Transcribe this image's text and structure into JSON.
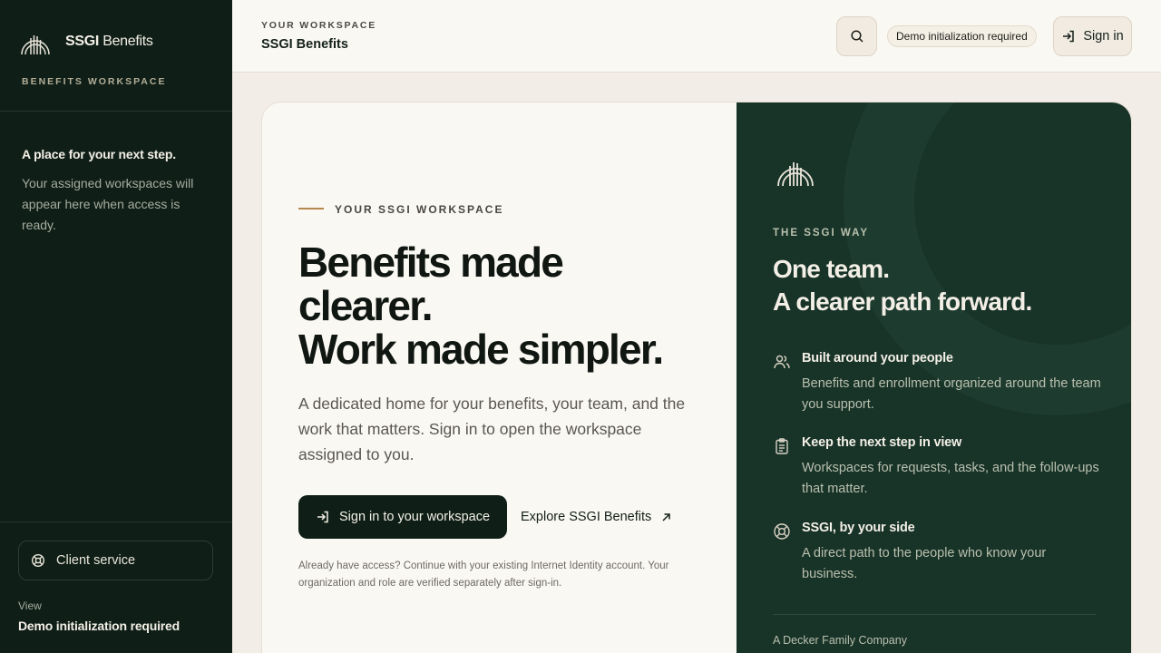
{
  "sidebar": {
    "brand_bold": "SSGI",
    "brand_rest": " Benefits",
    "subtitle": "BENEFITS WORKSPACE",
    "heading": "A place for your next step.",
    "text": "Your assigned workspaces will appear here when access is ready.",
    "client_service_label": "Client service",
    "view_label": "View",
    "view_value": "Demo initialization required"
  },
  "header": {
    "eyebrow": "YOUR WORKSPACE",
    "title": "SSGI Benefits",
    "search_icon": "search-icon",
    "badge": "Demo initialization required",
    "signin_label": "Sign in"
  },
  "main": {
    "eyebrow": "YOUR SSGI WORKSPACE",
    "headline": [
      "Benefits made",
      "clearer.",
      "Work made simpler."
    ],
    "description": "A dedicated home for your benefits, your team, and the work that matters. Sign in to open the workspace assigned to you.",
    "primary_button": "Sign in to your workspace",
    "explore_link": "Explore SSGI Benefits",
    "fine_print": "Already have access? Continue with your existing Internet Identity account. Your organization and role are verified separately after sign-in."
  },
  "panel": {
    "eyebrow": "THE SSGI WAY",
    "title": [
      "One team.",
      "A clearer path forward."
    ],
    "features": [
      {
        "icon": "people-icon",
        "title": "Built around your people",
        "desc": "Benefits and enrollment organized around the team you support."
      },
      {
        "icon": "clipboard-icon",
        "title": "Keep the next step in view",
        "desc": "Workspaces for requests, tasks, and the follow-ups that matter."
      },
      {
        "icon": "lifebuoy-icon",
        "title": "SSGI, by your side",
        "desc": "A direct path to the people who know your business."
      }
    ],
    "footer": "A Decker Family Company"
  },
  "colors": {
    "sidebar_bg": "#0f1f17",
    "panel_bg": "#183328",
    "accent": "#b5884f",
    "page_bg": "#f2ede6"
  }
}
